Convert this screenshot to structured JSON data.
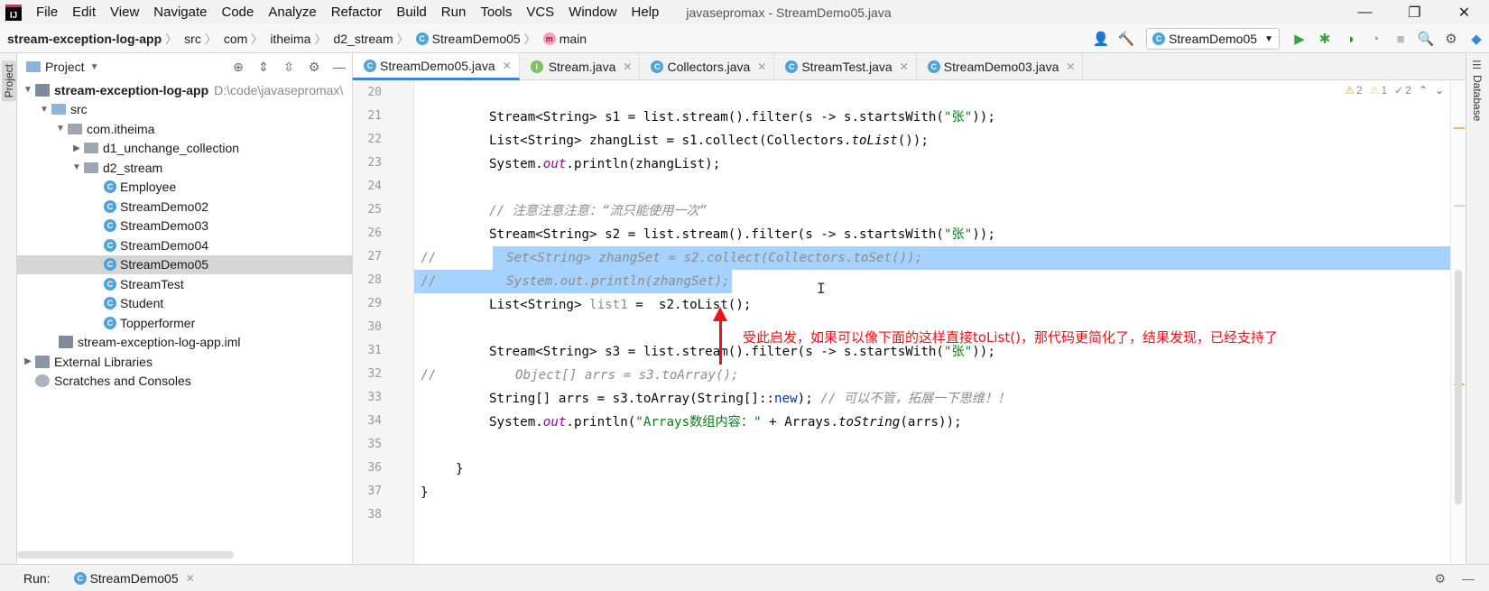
{
  "menu": {
    "items": [
      "File",
      "Edit",
      "View",
      "Navigate",
      "Code",
      "Analyze",
      "Refactor",
      "Build",
      "Run",
      "Tools",
      "VCS",
      "Window",
      "Help"
    ],
    "window_title": "javasepromax - StreamDemo05.java"
  },
  "breadcrumb": {
    "project": "stream-exception-log-app",
    "items": [
      "src",
      "com",
      "itheima",
      "d2_stream"
    ],
    "class": "StreamDemo05",
    "method": "main"
  },
  "toolbar": {
    "run_config": "StreamDemo05"
  },
  "left_strip": {
    "label": "Project"
  },
  "right_strip": {
    "label": "Database"
  },
  "project_panel": {
    "title": "Project",
    "root": {
      "name": "stream-exception-log-app",
      "path": "D:\\code\\javasepromax\\"
    },
    "src": "src",
    "package": "com.itheima",
    "folders": [
      "d1_unchange_collection",
      "d2_stream"
    ],
    "files": [
      "Employee",
      "StreamDemo02",
      "StreamDemo03",
      "StreamDemo04",
      "StreamDemo05",
      "StreamTest",
      "Student",
      "Topperformer"
    ],
    "selected_file": "StreamDemo05",
    "iml": "stream-exception-log-app.iml",
    "external_libraries": "External Libraries",
    "scratches": "Scratches and Consoles"
  },
  "editor_tabs": [
    {
      "label": "StreamDemo05.java",
      "active": true
    },
    {
      "label": "Stream.java",
      "active": false
    },
    {
      "label": "Collectors.java",
      "active": false
    },
    {
      "label": "StreamTest.java",
      "active": false
    },
    {
      "label": "StreamDemo03.java",
      "active": false
    }
  ],
  "inspections": {
    "warnings": "2",
    "weak_warnings": "1",
    "typos": "2"
  },
  "editor": {
    "line_numbers": [
      "20",
      "21",
      "22",
      "23",
      "24",
      "25",
      "26",
      "27",
      "28",
      "29",
      "30",
      "31",
      "32",
      "33",
      "34",
      "35",
      "36",
      "37",
      "38"
    ],
    "line_21": {
      "a": "Stream<String> s1 = list.stream().filter(s -> s.startsWith(",
      "b": "\"张\"",
      "c": "));"
    },
    "line_22": {
      "a": "List<String> zhangList = s1.collect(Collectors.",
      "b": "toList",
      "c": "());"
    },
    "line_23": {
      "a": "System.",
      "b": "out",
      "c": ".println(zhangList);"
    },
    "line_25": "// 注意注意注意：“流只能使用一次”",
    "line_26": {
      "a": "Stream<String> s2 = list.stream().filter(s -> s.startsWith(",
      "b": "\"张\"",
      "c": "));"
    },
    "line_27": {
      "a": "//",
      "b": "Set<String> zhangSet = s2.collect(Collectors.toSet());"
    },
    "line_28": {
      "a": "//",
      "b": "System.out.println(zhangSet);"
    },
    "line_29": {
      "a": "List<String> ",
      "b": "list1",
      "c": " =  s2.toList();"
    },
    "line_31": {
      "a": "Stream<String> s3 = list.stream().filter(s -> s.startsWith(",
      "b": "\"张\"",
      "c": "));"
    },
    "line_32": {
      "a": "//",
      "b": "Object[] arrs = s3.toArray();"
    },
    "line_33": {
      "a": "String[] arrs = s3.toArray(String[]::",
      "b": "new",
      "c": "); ",
      "d": "// 可以不管，拓展一下思维！！"
    },
    "line_34": {
      "a": "System.",
      "b": "out",
      "c": ".println(",
      "d": "\"Arrays数组内容：\"",
      "e": " + Arrays.",
      "f": "toString",
      "g": "(arrs));"
    },
    "line_36": "}",
    "line_37": "}"
  },
  "annotation": "受此启发，如果可以像下面的这样直接toList()，那代码更简化了，结果发现，已经支持了",
  "bottom": {
    "run_label": "Run:",
    "run_tab": "StreamDemo05"
  }
}
